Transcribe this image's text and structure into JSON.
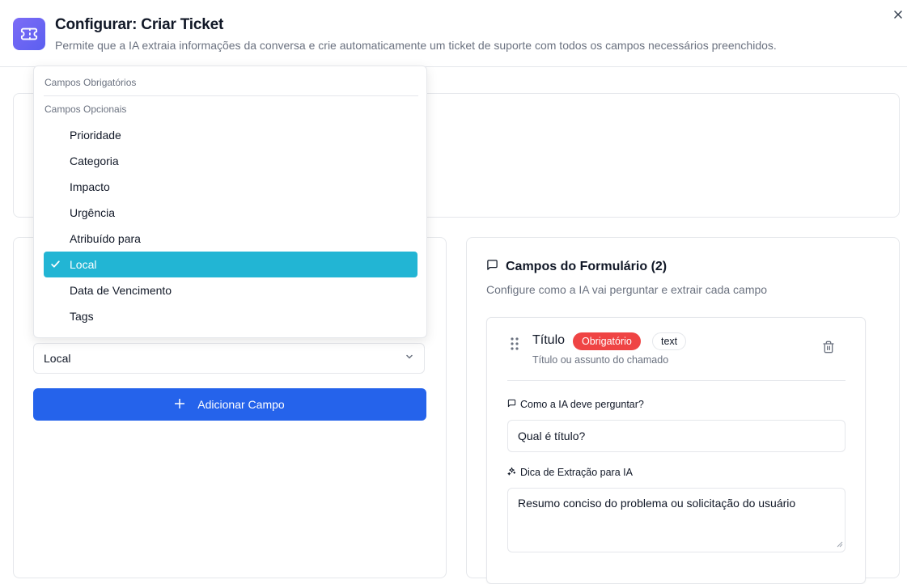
{
  "header": {
    "title": "Configurar: Criar Ticket",
    "description": "Permite que a IA extraia informações da conversa e crie automaticamente um ticket de suporte com todos os campos necessários preenchidos.",
    "icon": "ticket-icon",
    "accent": "#6366f1"
  },
  "dropdown": {
    "group_required": "Campos Obrigatórios",
    "group_optional": "Campos Opcionais",
    "items": [
      {
        "label": "Prioridade"
      },
      {
        "label": "Categoria"
      },
      {
        "label": "Impacto"
      },
      {
        "label": "Urgência"
      },
      {
        "label": "Atribuído para"
      },
      {
        "label": "Local",
        "selected": true
      },
      {
        "label": "Data de Vencimento"
      },
      {
        "label": "Tags"
      }
    ],
    "selected_color": "#22b5d4"
  },
  "add_field": {
    "select_value": "Local",
    "button_label": "Adicionar Campo",
    "button_color": "#2563eb"
  },
  "form_fields": {
    "title": "Campos do Formulário (2)",
    "subtitle": "Configure como a IA vai perguntar e extrair cada campo",
    "field": {
      "name": "Título",
      "required_badge": "Obrigatório",
      "type_badge": "text",
      "description": "Título ou assunto do chamado",
      "ask_label": "Como a IA deve perguntar?",
      "ask_value": "Qual é título?",
      "hint_label": "Dica de Extração para IA",
      "hint_value": "Resumo conciso do problema ou solicitação do usuário"
    }
  }
}
